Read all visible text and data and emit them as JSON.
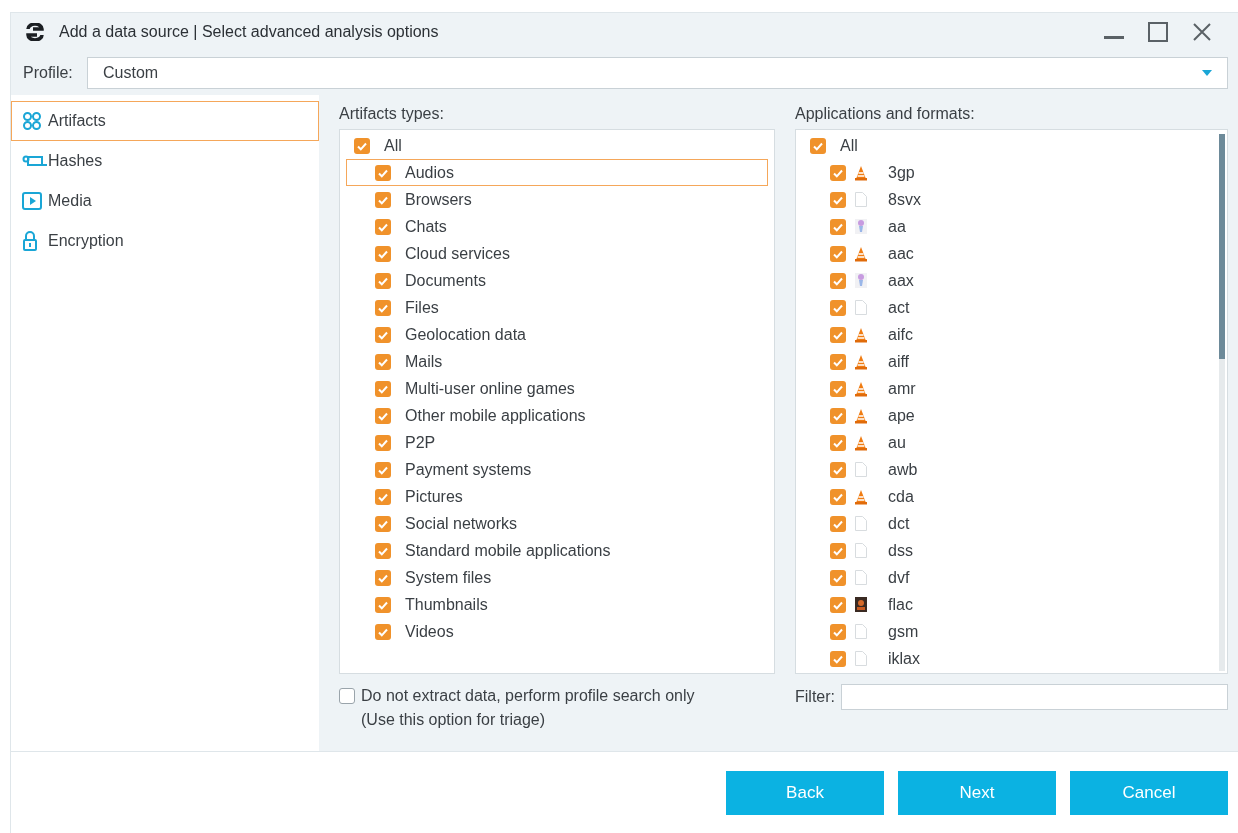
{
  "window": {
    "title": "Add a data source | Select advanced analysis options"
  },
  "profile": {
    "label": "Profile:",
    "value": "Custom"
  },
  "sidebar": {
    "items": [
      {
        "label": "Artifacts",
        "kind": "artifacts",
        "selected": true
      },
      {
        "label": "Hashes",
        "kind": "hashes",
        "selected": false
      },
      {
        "label": "Media",
        "kind": "media",
        "selected": false
      },
      {
        "label": "Encryption",
        "kind": "encryption",
        "selected": false
      }
    ]
  },
  "artifacts": {
    "heading": "Artifacts types:",
    "all": {
      "label": "All",
      "checked": true
    },
    "items": [
      {
        "label": "Audios",
        "checked": true,
        "selected": true
      },
      {
        "label": "Browsers",
        "checked": true,
        "selected": false
      },
      {
        "label": "Chats",
        "checked": true,
        "selected": false
      },
      {
        "label": "Cloud services",
        "checked": true,
        "selected": false
      },
      {
        "label": "Documents",
        "checked": true,
        "selected": false
      },
      {
        "label": "Files",
        "checked": true,
        "selected": false
      },
      {
        "label": "Geolocation data",
        "checked": true,
        "selected": false
      },
      {
        "label": "Mails",
        "checked": true,
        "selected": false
      },
      {
        "label": "Multi-user online games",
        "checked": true,
        "selected": false
      },
      {
        "label": "Other mobile applications",
        "checked": true,
        "selected": false
      },
      {
        "label": "P2P",
        "checked": true,
        "selected": false
      },
      {
        "label": "Payment systems",
        "checked": true,
        "selected": false
      },
      {
        "label": "Pictures",
        "checked": true,
        "selected": false
      },
      {
        "label": "Social networks",
        "checked": true,
        "selected": false
      },
      {
        "label": "Standard mobile applications",
        "checked": true,
        "selected": false
      },
      {
        "label": "System files",
        "checked": true,
        "selected": false
      },
      {
        "label": "Thumbnails",
        "checked": true,
        "selected": false
      },
      {
        "label": "Videos",
        "checked": true,
        "selected": false
      }
    ]
  },
  "formats": {
    "heading": "Applications and formats:",
    "all": {
      "label": "All",
      "checked": true
    },
    "items": [
      {
        "label": "3gp",
        "checked": true,
        "kind": "cone"
      },
      {
        "label": "8svx",
        "checked": true,
        "kind": "file"
      },
      {
        "label": "aa",
        "checked": true,
        "kind": "figure"
      },
      {
        "label": "aac",
        "checked": true,
        "kind": "cone"
      },
      {
        "label": "aax",
        "checked": true,
        "kind": "figure"
      },
      {
        "label": "act",
        "checked": true,
        "kind": "file"
      },
      {
        "label": "aifc",
        "checked": true,
        "kind": "cone"
      },
      {
        "label": "aiff",
        "checked": true,
        "kind": "cone"
      },
      {
        "label": "amr",
        "checked": true,
        "kind": "cone"
      },
      {
        "label": "ape",
        "checked": true,
        "kind": "cone"
      },
      {
        "label": "au",
        "checked": true,
        "kind": "cone"
      },
      {
        "label": "awb",
        "checked": true,
        "kind": "file"
      },
      {
        "label": "cda",
        "checked": true,
        "kind": "cone"
      },
      {
        "label": "dct",
        "checked": true,
        "kind": "file"
      },
      {
        "label": "dss",
        "checked": true,
        "kind": "file"
      },
      {
        "label": "dvf",
        "checked": true,
        "kind": "file"
      },
      {
        "label": "flac",
        "checked": true,
        "kind": "dark"
      },
      {
        "label": "gsm",
        "checked": true,
        "kind": "file"
      },
      {
        "label": "iklax",
        "checked": true,
        "kind": "file"
      }
    ]
  },
  "triage": {
    "label": "Do not extract data, perform profile search only",
    "note": "(Use this option for triage)",
    "checked": false
  },
  "filter": {
    "label": "Filter:"
  },
  "buttons": [
    "Back",
    "Next",
    "Cancel"
  ]
}
